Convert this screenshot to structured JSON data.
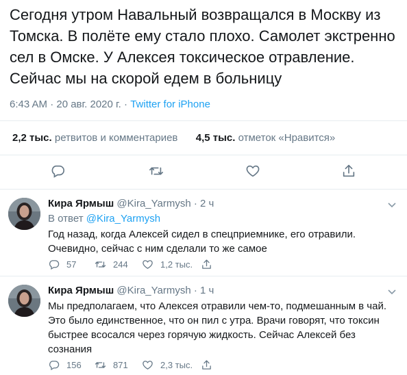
{
  "tweet": {
    "text": "Сегодня утром Навальный возвращался в Москву из Томска. В полёте ему стало плохо. Самолет экстренно сел в Омске. У Алексея токсическое отравление. Сейчас мы на скорой едем в больницу",
    "timestamp": "6:43 AM · 20 авг. 2020 г. · ",
    "source": "Twitter for iPhone",
    "retweets_count": "2,2 тыс.",
    "retweets_label": " ретвитов и комментариев",
    "likes_count": "4,5 тыс.",
    "likes_label": " отметок «Нравится»"
  },
  "icons": {
    "reply": "reply-icon",
    "retweet": "retweet-icon",
    "like": "like-icon",
    "share": "share-icon",
    "more": "chevron-down-icon"
  },
  "colors": {
    "link": "#1da1f2",
    "muted": "#657786",
    "divider": "#e6ecf0"
  },
  "replies": [
    {
      "name": "Кира Ярмыш",
      "meta": " @Kira_Yarmysh · 2 ч",
      "in_reply_prefix": "В ответ ",
      "in_reply_handle": "@Kira_Yarmysh",
      "text": "Год назад, когда Алексей сидел в спецприемнике, его отравили. Очевидно, сейчас с ним сделали то же самое",
      "reply_count": "57",
      "retweet_count": "244",
      "like_count": "1,2 тыс."
    },
    {
      "name": "Кира Ярмыш",
      "meta": " @Kira_Yarmysh · 1 ч",
      "text": "Мы предполагаем, что Алексея отравили чем-то, подмешанным в чай. Это было единственное, что он пил с утра. Врачи говорят, что токсин быстрее всосался через горячую жидкость. Сейчас Алексей без сознания",
      "reply_count": "156",
      "retweet_count": "871",
      "like_count": "2,3 тыс."
    }
  ]
}
